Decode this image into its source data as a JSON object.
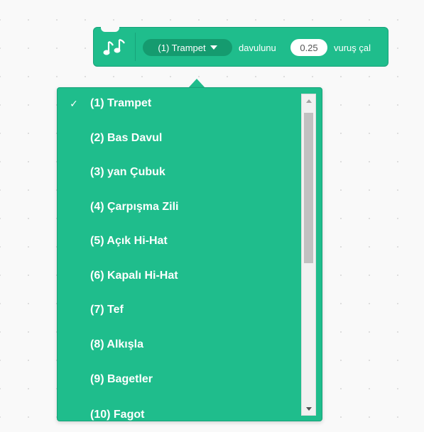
{
  "block": {
    "icon": "music-notes-icon",
    "selected_drum": "(1) Trampet",
    "text_drum": "davulunu",
    "beats_value": "0.25",
    "text_beats": "vuruş çal",
    "color": "#1fbd8c"
  },
  "menu": {
    "check_glyph": "✓",
    "items": [
      {
        "label": "(1) Trampet",
        "checked": true
      },
      {
        "label": "(2) Bas Davul"
      },
      {
        "label": "(3) yan Çubuk"
      },
      {
        "label": "(4) Çarpışma Zili"
      },
      {
        "label": "(5) Açık Hi-Hat"
      },
      {
        "label": "(6) Kapalı Hi-Hat"
      },
      {
        "label": "(7) Tef"
      },
      {
        "label": "(8) Alkışla"
      },
      {
        "label": "(9) Bagetler"
      },
      {
        "label": "(10) Fagot"
      }
    ]
  }
}
